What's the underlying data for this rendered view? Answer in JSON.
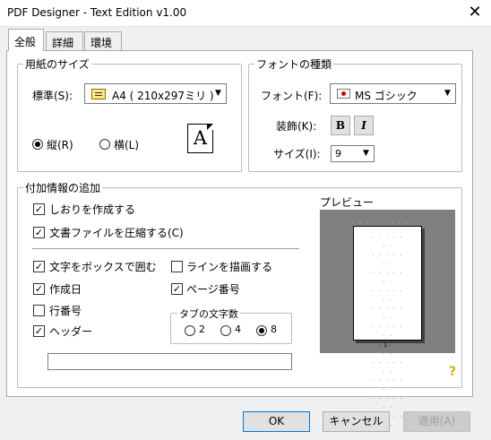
{
  "window": {
    "title": "PDF Designer - Text Edition v1.00",
    "close_glyph": "✕"
  },
  "tabs": [
    {
      "label": "全般",
      "active": true
    },
    {
      "label": "詳細",
      "active": false
    },
    {
      "label": "環境",
      "active": false
    }
  ],
  "paper_size": {
    "group_label": "用紙のサイズ",
    "standard_label": "標準(S):",
    "standard_value": "A4 ( 210x297ミリ )",
    "orientation_portrait": "縦(R)",
    "orientation_landscape": "横(L)",
    "selected_orientation": "portrait",
    "orientation_glyph": "A"
  },
  "font_type": {
    "group_label": "フォントの種類",
    "font_label": "フォント(F):",
    "font_value": "MS ゴシック",
    "decoration_label": "装飾(K):",
    "bold_label": "B",
    "italic_label": "I",
    "size_label": "サイズ(I):",
    "size_value": "9"
  },
  "additional_info": {
    "group_label": "付加情報の追加",
    "create_bookmarks": {
      "label": "しおりを作成する",
      "checked": true
    },
    "compress_file": {
      "label": "文書ファイルを圧縮する(C)",
      "checked": true
    },
    "box_text": {
      "label": "文字をボックスで囲む",
      "checked": true
    },
    "draw_lines": {
      "label": "ラインを描画する",
      "checked": false
    },
    "creation_date": {
      "label": "作成日",
      "checked": true
    },
    "page_number": {
      "label": "ページ番号",
      "checked": true
    },
    "line_number": {
      "label": "行番号",
      "checked": false
    },
    "header": {
      "label": "ヘッダー",
      "checked": true
    },
    "tab_width": {
      "group_label": "タブの文字数",
      "options": [
        "2",
        "4",
        "8"
      ],
      "selected": "8"
    },
    "header_text_value": ""
  },
  "preview": {
    "label": "プレビュー",
    "page_footer": "- 1 -"
  },
  "help_glyph": "?",
  "buttons": {
    "ok": "OK",
    "cancel": "キャンセル",
    "apply": "適用(A)"
  },
  "colors": {
    "preview_bg": "#808080",
    "help_icon": "#d4b000",
    "default_border": "#0078d7"
  }
}
